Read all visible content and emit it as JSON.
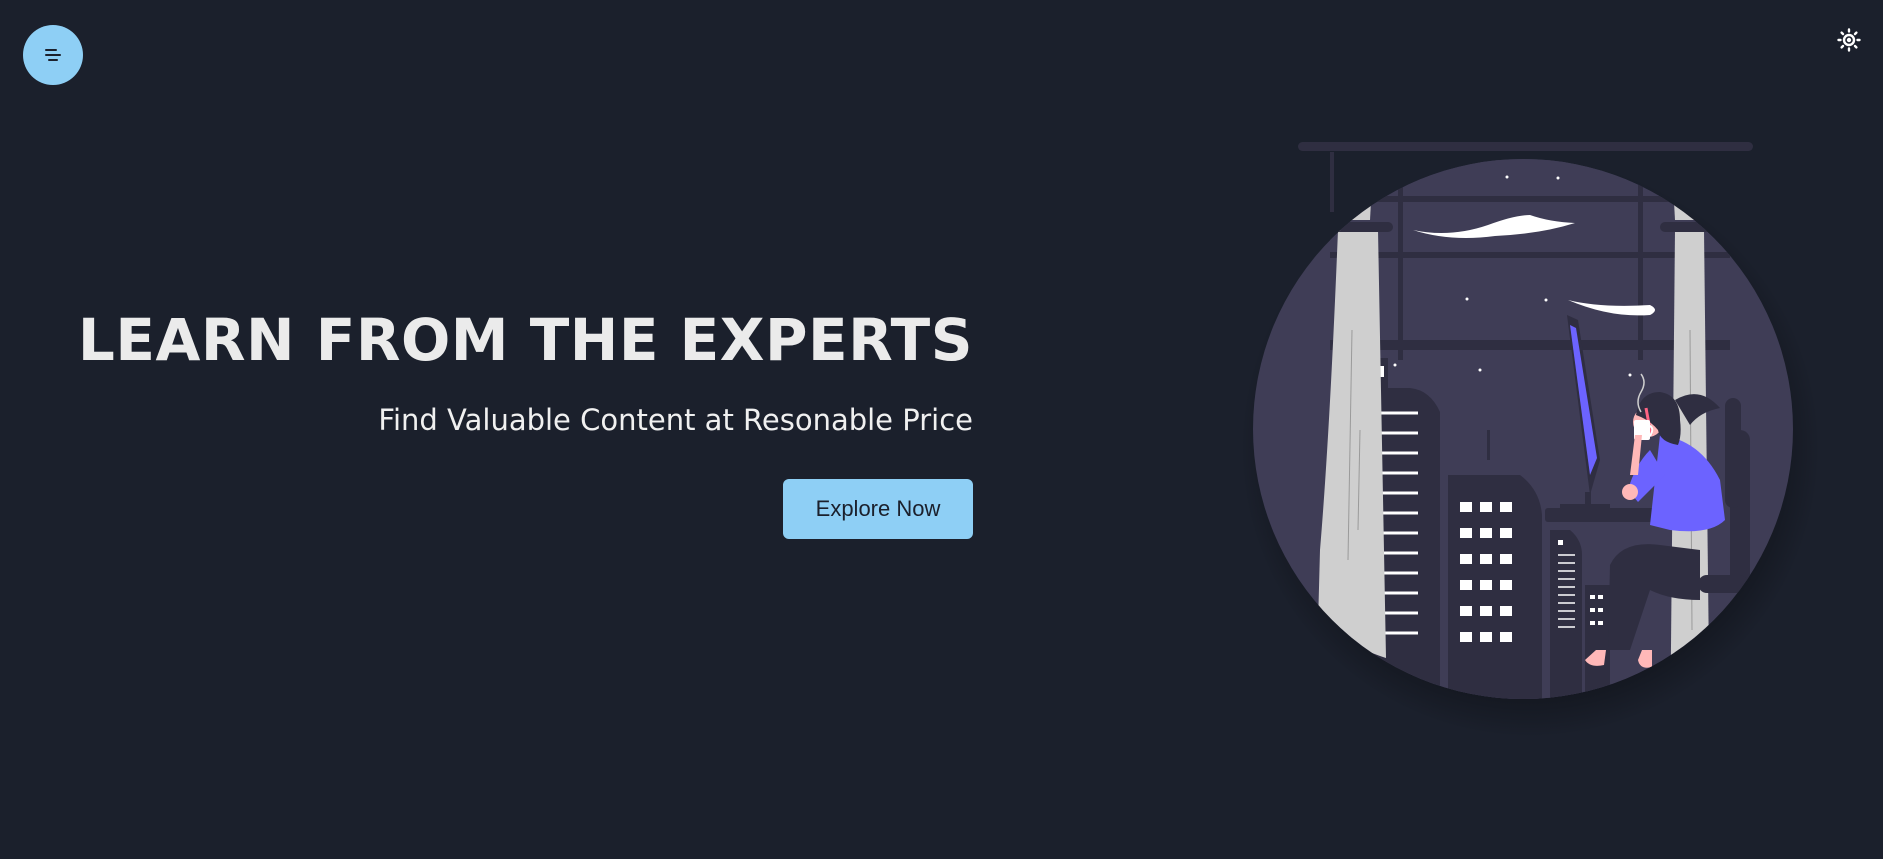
{
  "header": {
    "menu_icon": "menu-lines-icon",
    "theme_icon": "sun-icon"
  },
  "hero": {
    "title": "LEARN FROM THE EXPERTS",
    "subtitle": "Find Valuable Content at Resonable Price",
    "cta_label": "Explore Now"
  },
  "colors": {
    "background": "#1b202c",
    "accent": "#8ecff5",
    "illustration_purple": "#3f3d56",
    "illustration_violet": "#6c63ff"
  }
}
